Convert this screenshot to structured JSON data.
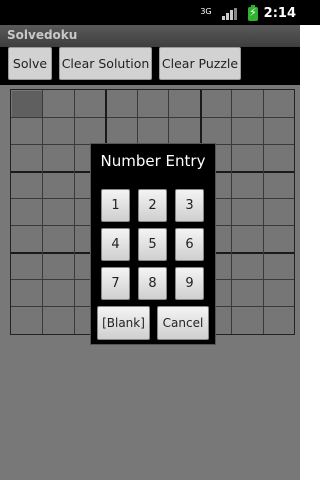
{
  "status_bar": {
    "network": "3G",
    "time": "2:14",
    "icons": [
      "network-3g-icon",
      "signal-icon",
      "battery-charging-icon"
    ]
  },
  "app": {
    "title": "Solvedoku"
  },
  "toolbar": {
    "solve_label": "Solve",
    "clear_solution_label": "Clear Solution",
    "clear_puzzle_label": "Clear Puzzle"
  },
  "grid": {
    "rows": 9,
    "cols": 9,
    "selected_cell": "row 1, col 1"
  },
  "dialog": {
    "title": "Number Entry",
    "numbers": [
      "1",
      "2",
      "3",
      "4",
      "5",
      "6",
      "7",
      "8",
      "9"
    ],
    "blank_label": "[Blank]",
    "cancel_label": "Cancel"
  }
}
